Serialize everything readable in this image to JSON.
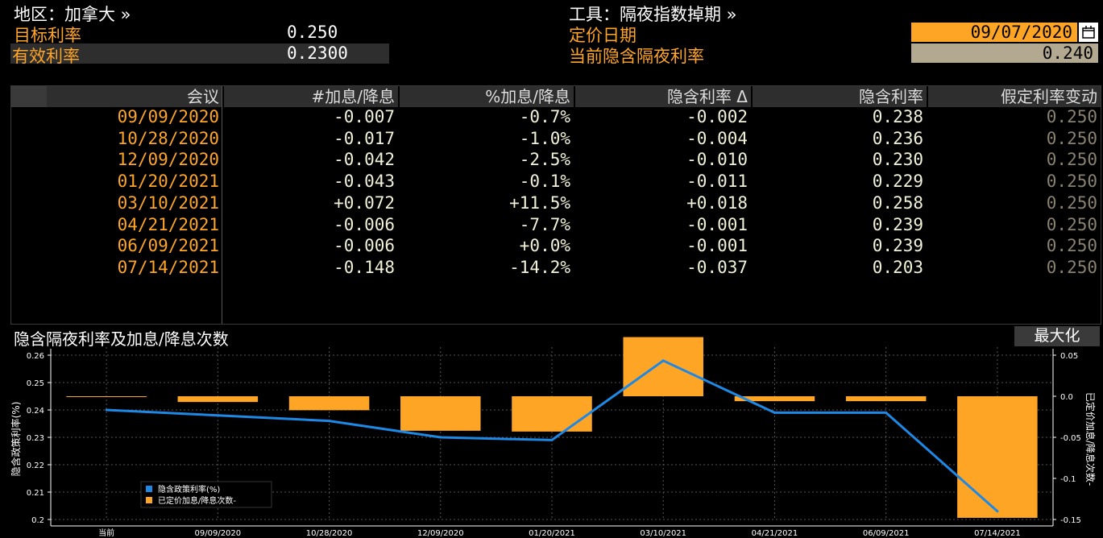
{
  "header": {
    "region_label": "地区：加拿大 »",
    "target_rate_label": "目标利率",
    "target_rate_value": "0.250",
    "effective_rate_label": "有效利率",
    "effective_rate_value": "0.2300",
    "tool_label": "工具：隔夜指数掉期 »",
    "pricing_date_label": "定价日期",
    "pricing_date_value": "09/07/2020",
    "implied_rate_label": "当前隐含隔夜利率",
    "implied_rate_value": "0.240"
  },
  "table": {
    "columns": [
      "会议",
      "#加息/降息",
      "%加息/降息",
      "隐含利率 Δ",
      "隐含利率",
      "假定利率变动"
    ],
    "rows": [
      [
        "09/09/2020",
        "-0.007",
        "-0.7%",
        "-0.002",
        "0.238",
        "0.250"
      ],
      [
        "10/28/2020",
        "-0.017",
        "-1.0%",
        "-0.004",
        "0.236",
        "0.250"
      ],
      [
        "12/09/2020",
        "-0.042",
        "-2.5%",
        "-0.010",
        "0.230",
        "0.250"
      ],
      [
        "01/20/2021",
        "-0.043",
        "-0.1%",
        "-0.011",
        "0.229",
        "0.250"
      ],
      [
        "03/10/2021",
        "+0.072",
        "+11.5%",
        "+0.018",
        "0.258",
        "0.250"
      ],
      [
        "04/21/2021",
        "-0.006",
        "-7.7%",
        "-0.001",
        "0.239",
        "0.250"
      ],
      [
        "06/09/2021",
        "-0.006",
        "+0.0%",
        "-0.001",
        "0.239",
        "0.250"
      ],
      [
        "07/14/2021",
        "-0.148",
        "-14.2%",
        "-0.037",
        "0.203",
        "0.250"
      ]
    ]
  },
  "chart_panel": {
    "title": "隐含隔夜利率及加息/降息次数",
    "maximize_label": "最大化"
  },
  "chart_data": {
    "type": "bar",
    "categories": [
      "当前",
      "09/09/2020",
      "10/28/2020",
      "12/09/2020",
      "01/20/2021",
      "03/10/2021",
      "04/21/2021",
      "06/09/2021",
      "07/14/2021"
    ],
    "series": [
      {
        "name": "隐含政策利率(%)",
        "type": "line",
        "axis": "left",
        "color": "#1e88e5",
        "values": [
          0.24,
          0.238,
          0.236,
          0.23,
          0.229,
          0.258,
          0.239,
          0.239,
          0.203
        ]
      },
      {
        "name": "已定价加息/降息次数-",
        "type": "bar",
        "axis": "right",
        "color": "#ffa526",
        "values": [
          0.0,
          -0.007,
          -0.017,
          -0.042,
          -0.043,
          0.072,
          -0.006,
          -0.006,
          -0.148
        ]
      }
    ],
    "ylabel": "隐含政策利率(%)",
    "ylabel_right": "已定价加息/降息次数-",
    "ylim": [
      0.2,
      0.26
    ],
    "ylim_right": [
      -0.15,
      0.05
    ],
    "yticks": [
      "0.2",
      "0.21",
      "0.22",
      "0.23",
      "0.24",
      "0.25",
      "0.26"
    ],
    "yticks_right": [
      "-0.15",
      "-0.1",
      "-0.05",
      "0.0",
      "0.05"
    ],
    "grid": true,
    "legend_position": "bottom-left"
  }
}
